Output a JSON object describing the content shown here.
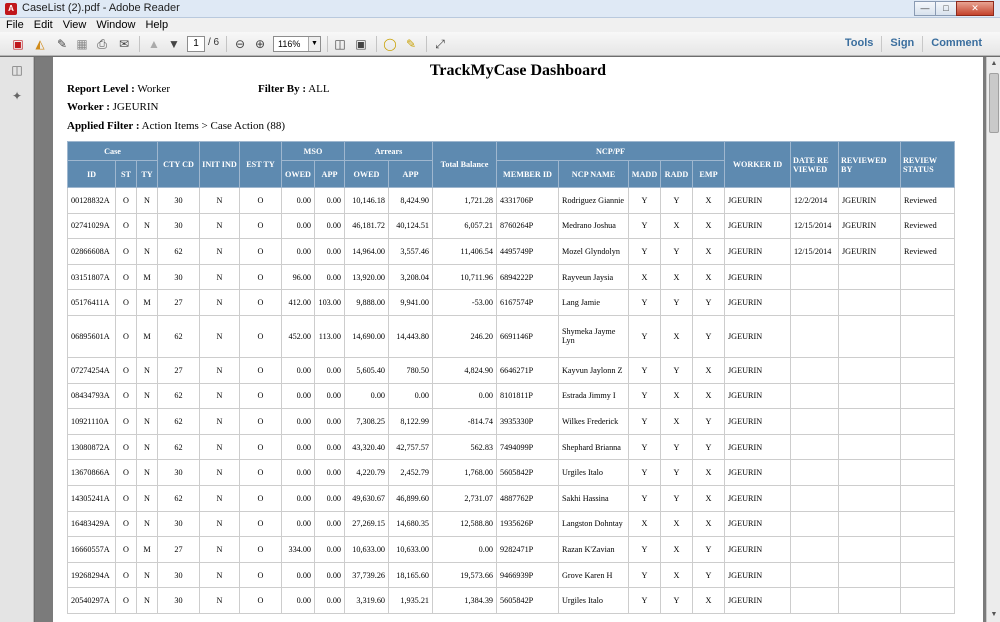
{
  "window": {
    "title": "CaseList (2).pdf - Adobe Reader",
    "icon": "pdf-icon"
  },
  "menu": [
    "File",
    "Edit",
    "View",
    "Window",
    "Help"
  ],
  "toolbar": {
    "page_current": "1",
    "page_total": "/ 6",
    "zoom": "116%",
    "right_tools": [
      "Tools",
      "Sign",
      "Comment"
    ]
  },
  "report": {
    "title": "TrackMyCase Dashboard",
    "report_level_label": "Report Level :",
    "report_level_value": "Worker",
    "filter_by_label": "Filter By :",
    "filter_by_value": "ALL",
    "worker_label": "Worker :",
    "worker_value": "JGEURIN",
    "applied_filter_label": "Applied Filter :",
    "applied_filter_value": "Action Items > Case Action (88)"
  },
  "table": {
    "group_headers": {
      "case": "Case",
      "cty_cd": "CTY CD",
      "init_ind": "INIT IND",
      "est_ty": "EST TY",
      "mso": "MSO",
      "arrears": "Arrears",
      "total_balance": "Total Balance",
      "ncp": "NCP/PF",
      "worker_id": "WORKER ID",
      "date_reviewed": "DATE RE VIEWED",
      "reviewed_by": "REVIEWED BY",
      "review_status": "REVIEW STATUS"
    },
    "sub_headers": {
      "id": "ID",
      "st": "ST",
      "ty": "TY",
      "mso_owed": "OWED",
      "mso_app": "APP",
      "arr_owed": "OWED",
      "arr_app": "APP",
      "member_id": "MEMBER ID",
      "ncp_name": "NCP NAME",
      "madd": "MADD",
      "radd": "RADD",
      "emp": "EMP"
    },
    "rows": [
      {
        "id": "00128832A",
        "st": "O",
        "ty": "N",
        "cty": "30",
        "init": "N",
        "est": "O",
        "mso_owed": "0.00",
        "mso_app": "0.00",
        "arr_owed": "10,146.18",
        "arr_app": "8,424.90",
        "total": "1,721.28",
        "member": "4331706P",
        "name": "Rodriguez Giannie",
        "madd": "Y",
        "radd": "Y",
        "emp": "X",
        "worker": "JGEURIN",
        "date": "12/2/2014",
        "by": "JGEURIN",
        "status": "Reviewed"
      },
      {
        "id": "02741029A",
        "st": "O",
        "ty": "N",
        "cty": "30",
        "init": "N",
        "est": "O",
        "mso_owed": "0.00",
        "mso_app": "0.00",
        "arr_owed": "46,181.72",
        "arr_app": "40,124.51",
        "total": "6,057.21",
        "member": "8760264P",
        "name": "Medrano Joshua",
        "madd": "Y",
        "radd": "X",
        "emp": "X",
        "worker": "JGEURIN",
        "date": "12/15/2014",
        "by": "JGEURIN",
        "status": "Reviewed"
      },
      {
        "id": "02866608A",
        "st": "O",
        "ty": "N",
        "cty": "62",
        "init": "N",
        "est": "O",
        "mso_owed": "0.00",
        "mso_app": "0.00",
        "arr_owed": "14,964.00",
        "arr_app": "3,557.46",
        "total": "11,406.54",
        "member": "4495749P",
        "name": "Mozel Glyndolyn",
        "madd": "Y",
        "radd": "Y",
        "emp": "X",
        "worker": "JGEURIN",
        "date": "12/15/2014",
        "by": "JGEURIN",
        "status": "Reviewed"
      },
      {
        "id": "03151807A",
        "st": "O",
        "ty": "M",
        "cty": "30",
        "init": "N",
        "est": "O",
        "mso_owed": "96.00",
        "mso_app": "0.00",
        "arr_owed": "13,920.00",
        "arr_app": "3,208.04",
        "total": "10,711.96",
        "member": "6894222P",
        "name": "Rayveun Jaysia",
        "madd": "X",
        "radd": "X",
        "emp": "X",
        "worker": "JGEURIN",
        "date": "",
        "by": "",
        "status": ""
      },
      {
        "id": "05176411A",
        "st": "O",
        "ty": "M",
        "cty": "27",
        "init": "N",
        "est": "O",
        "mso_owed": "412.00",
        "mso_app": "103.00",
        "arr_owed": "9,888.00",
        "arr_app": "9,941.00",
        "total": "-53.00",
        "member": "6167574P",
        "name": "Lang Jamie",
        "madd": "Y",
        "radd": "Y",
        "emp": "Y",
        "worker": "JGEURIN",
        "date": "",
        "by": "",
        "status": ""
      },
      {
        "id": "06895601A",
        "st": "O",
        "ty": "M",
        "cty": "62",
        "init": "N",
        "est": "O",
        "mso_owed": "452.00",
        "mso_app": "113.00",
        "arr_owed": "14,690.00",
        "arr_app": "14,443.80",
        "total": "246.20",
        "member": "6691146P",
        "name": "Shymeka Jayme Lyn",
        "madd": "Y",
        "radd": "X",
        "emp": "Y",
        "worker": "JGEURIN",
        "date": "",
        "by": "",
        "status": "",
        "tall": true
      },
      {
        "id": "07274254A",
        "st": "O",
        "ty": "N",
        "cty": "27",
        "init": "N",
        "est": "O",
        "mso_owed": "0.00",
        "mso_app": "0.00",
        "arr_owed": "5,605.40",
        "arr_app": "780.50",
        "total": "4,824.90",
        "member": "6646271P",
        "name": "Kayvun Jaylonn Z",
        "madd": "Y",
        "radd": "Y",
        "emp": "X",
        "worker": "JGEURIN",
        "date": "",
        "by": "",
        "status": ""
      },
      {
        "id": "08434793A",
        "st": "O",
        "ty": "N",
        "cty": "62",
        "init": "N",
        "est": "O",
        "mso_owed": "0.00",
        "mso_app": "0.00",
        "arr_owed": "0.00",
        "arr_app": "0.00",
        "total": "0.00",
        "member": "8101811P",
        "name": "Estrada Jimmy I",
        "madd": "Y",
        "radd": "X",
        "emp": "X",
        "worker": "JGEURIN",
        "date": "",
        "by": "",
        "status": ""
      },
      {
        "id": "10921110A",
        "st": "O",
        "ty": "N",
        "cty": "62",
        "init": "N",
        "est": "O",
        "mso_owed": "0.00",
        "mso_app": "0.00",
        "arr_owed": "7,308.25",
        "arr_app": "8,122.99",
        "total": "-814.74",
        "member": "3935330P",
        "name": "Wilkes Frederick",
        "madd": "Y",
        "radd": "X",
        "emp": "Y",
        "worker": "JGEURIN",
        "date": "",
        "by": "",
        "status": ""
      },
      {
        "id": "13080872A",
        "st": "O",
        "ty": "N",
        "cty": "62",
        "init": "N",
        "est": "O",
        "mso_owed": "0.00",
        "mso_app": "0.00",
        "arr_owed": "43,320.40",
        "arr_app": "42,757.57",
        "total": "562.83",
        "member": "7494099P",
        "name": "Shephard Brianna",
        "madd": "Y",
        "radd": "Y",
        "emp": "Y",
        "worker": "JGEURIN",
        "date": "",
        "by": "",
        "status": ""
      },
      {
        "id": "13670866A",
        "st": "O",
        "ty": "N",
        "cty": "30",
        "init": "N",
        "est": "O",
        "mso_owed": "0.00",
        "mso_app": "0.00",
        "arr_owed": "4,220.79",
        "arr_app": "2,452.79",
        "total": "1,768.00",
        "member": "5605842P",
        "name": "Urgiles Italo",
        "madd": "Y",
        "radd": "Y",
        "emp": "X",
        "worker": "JGEURIN",
        "date": "",
        "by": "",
        "status": ""
      },
      {
        "id": "14305241A",
        "st": "O",
        "ty": "N",
        "cty": "62",
        "init": "N",
        "est": "O",
        "mso_owed": "0.00",
        "mso_app": "0.00",
        "arr_owed": "49,630.67",
        "arr_app": "46,899.60",
        "total": "2,731.07",
        "member": "4887762P",
        "name": "Sakhi Hassina",
        "madd": "Y",
        "radd": "Y",
        "emp": "X",
        "worker": "JGEURIN",
        "date": "",
        "by": "",
        "status": ""
      },
      {
        "id": "16483429A",
        "st": "O",
        "ty": "N",
        "cty": "30",
        "init": "N",
        "est": "O",
        "mso_owed": "0.00",
        "mso_app": "0.00",
        "arr_owed": "27,269.15",
        "arr_app": "14,680.35",
        "total": "12,588.80",
        "member": "1935626P",
        "name": "Langston Dohntay",
        "madd": "X",
        "radd": "X",
        "emp": "X",
        "worker": "JGEURIN",
        "date": "",
        "by": "",
        "status": ""
      },
      {
        "id": "16660557A",
        "st": "O",
        "ty": "M",
        "cty": "27",
        "init": "N",
        "est": "O",
        "mso_owed": "334.00",
        "mso_app": "0.00",
        "arr_owed": "10,633.00",
        "arr_app": "10,633.00",
        "total": "0.00",
        "member": "9282471P",
        "name": "Razan K'Zavian",
        "madd": "Y",
        "radd": "X",
        "emp": "Y",
        "worker": "JGEURIN",
        "date": "",
        "by": "",
        "status": ""
      },
      {
        "id": "19268294A",
        "st": "O",
        "ty": "N",
        "cty": "30",
        "init": "N",
        "est": "O",
        "mso_owed": "0.00",
        "mso_app": "0.00",
        "arr_owed": "37,739.26",
        "arr_app": "18,165.60",
        "total": "19,573.66",
        "member": "9466939P",
        "name": "Grove Karen H",
        "madd": "Y",
        "radd": "X",
        "emp": "Y",
        "worker": "JGEURIN",
        "date": "",
        "by": "",
        "status": ""
      },
      {
        "id": "20540297A",
        "st": "O",
        "ty": "N",
        "cty": "30",
        "init": "N",
        "est": "O",
        "mso_owed": "0.00",
        "mso_app": "0.00",
        "arr_owed": "3,319.60",
        "arr_app": "1,935.21",
        "total": "1,384.39",
        "member": "5605842P",
        "name": "Urgiles Italo",
        "madd": "Y",
        "radd": "Y",
        "emp": "X",
        "worker": "JGEURIN",
        "date": "",
        "by": "",
        "status": ""
      }
    ]
  }
}
